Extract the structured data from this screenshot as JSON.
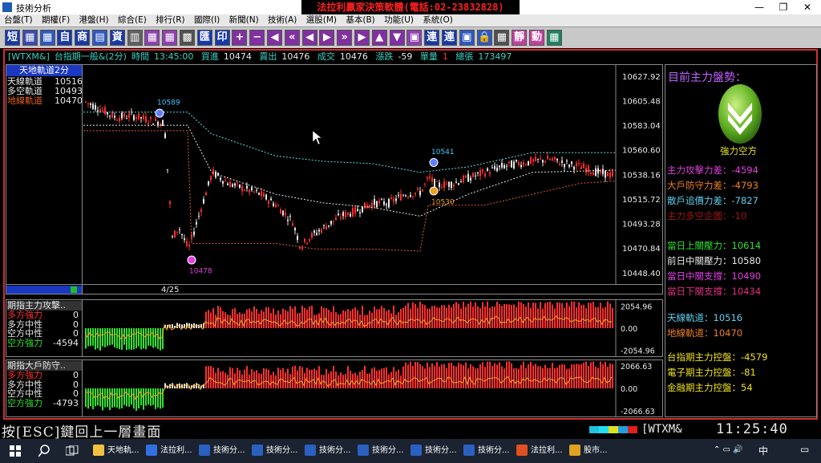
{
  "window": {
    "title": "技術分析",
    "banner": "法拉利贏家決策軟體(電話:02-23832828)",
    "controls": [
      "—",
      "❐",
      "✕"
    ]
  },
  "menu": [
    "台盤(T)",
    "期權(F)",
    "港盤(H)",
    "綜合(E)",
    "排行(R)",
    "國際(I)",
    "新聞(N)",
    "技術(A)",
    "選股(M)",
    "基本(B)",
    "功能(U)",
    "系統(O)"
  ],
  "toolbar": [
    {
      "label": "短",
      "bg": "#1838a8",
      "fg": "#fff"
    },
    {
      "label": "▦",
      "bg": "#3a4ab0",
      "fg": "#fff"
    },
    {
      "label": "▦",
      "bg": "#2c58c0",
      "fg": "#fff"
    },
    {
      "label": "自",
      "bg": "#1838a8",
      "fg": "#fff"
    },
    {
      "label": "商",
      "bg": "#1838a8",
      "fg": "#fff"
    },
    {
      "label": "▤",
      "bg": "#2c58c0",
      "fg": "#fff"
    },
    {
      "label": "資",
      "bg": "#1838a8",
      "fg": "#fff"
    },
    {
      "label": "▥",
      "bg": "#606060",
      "fg": "#fff"
    },
    {
      "label": "▦",
      "bg": "#9040b0",
      "fg": "#fff"
    },
    {
      "label": "▦",
      "bg": "#9040b0",
      "fg": "#fff"
    },
    {
      "label": "▩",
      "bg": "#505050",
      "fg": "#fff"
    },
    {
      "label": "匯",
      "bg": "#1838a8",
      "fg": "#fff"
    },
    {
      "label": "印",
      "bg": "#1838a8",
      "fg": "#fff"
    },
    {
      "label": "+",
      "bg": "#8030a0",
      "fg": "#fff"
    },
    {
      "label": "−",
      "bg": "#8030a0",
      "fg": "#fff"
    },
    {
      "label": "◀",
      "bg": "#8030a0",
      "fg": "#fff"
    },
    {
      "label": "«",
      "bg": "#8030a0",
      "fg": "#fff"
    },
    {
      "label": "◀",
      "bg": "#8030a0",
      "fg": "#fff"
    },
    {
      "label": "▶",
      "bg": "#8030a0",
      "fg": "#fff"
    },
    {
      "label": "»",
      "bg": "#8030a0",
      "fg": "#fff"
    },
    {
      "label": "▶",
      "bg": "#8030a0",
      "fg": "#fff"
    },
    {
      "label": "▲",
      "bg": "#8030a0",
      "fg": "#fff"
    },
    {
      "label": "▼",
      "bg": "#8030a0",
      "fg": "#fff"
    },
    {
      "label": "▣",
      "bg": "#9040b0",
      "fg": "#fff"
    },
    {
      "label": "連",
      "bg": "#1838a8",
      "fg": "#fff"
    },
    {
      "label": "連",
      "bg": "#1838a8",
      "fg": "#fff"
    },
    {
      "label": "▣",
      "bg": "#2c58c0",
      "fg": "#fff"
    },
    {
      "label": "🔒",
      "bg": "#2c58c0",
      "fg": "#fff"
    },
    {
      "label": "▦",
      "bg": "#505050",
      "fg": "#fff"
    },
    {
      "label": "靜",
      "bg": "#c040a0",
      "fg": "#fff"
    },
    {
      "label": "動",
      "bg": "#c040a0",
      "fg": "#fff"
    },
    {
      "label": "▦",
      "bg": "#208060",
      "fg": "#fff"
    }
  ],
  "infobar": {
    "symbol": "[WTXM&]",
    "name": "台指期一般&(2分)",
    "time_label": "時間",
    "time": "13:45:00",
    "bid_label": "買進",
    "bid": "10474",
    "ask_label": "賣出",
    "ask": "10476",
    "deal_label": "成交",
    "deal": "10476",
    "change_label": "漲跌",
    "change": "-59",
    "vol_label": "單量",
    "vol": "1",
    "total_label": "總張",
    "total": "173497"
  },
  "main_chart": {
    "title": "天地軌道2分",
    "legend": [
      {
        "label": "天線軌道",
        "value": "10516",
        "color": "#e8e8e8"
      },
      {
        "label": "多空軌道",
        "value": "10493",
        "color": "#e8e8e8"
      },
      {
        "label": "地線軌道",
        "value": "10470",
        "color": "#e06020"
      }
    ],
    "annotations": [
      {
        "text": "10589",
        "color": "#40c8ff"
      },
      {
        "text": "10541",
        "color": "#40c8ff"
      },
      {
        "text": "10530",
        "color": "#f0a020"
      },
      {
        "text": "10478",
        "color": "#e040e0"
      }
    ],
    "date_label": "4/25"
  },
  "chart_data": [
    {
      "type": "candlestick",
      "title": "天地軌道2分",
      "y_ticks": [
        "10627.92",
        "10605.48",
        "10583.04",
        "10560.60",
        "10538.16",
        "10515.72",
        "10493.28",
        "10470.84",
        "10448.40"
      ],
      "ylim": [
        10438,
        10638
      ],
      "x_label": "4/25",
      "series": [
        {
          "name": "天線軌道",
          "color": "#60e0e0",
          "style": "dotted",
          "points": [
            [
              0,
              10595
            ],
            [
              130,
              10595
            ],
            [
              160,
              10575
            ],
            [
              240,
              10555
            ],
            [
              300,
              10550
            ],
            [
              360,
              10548
            ],
            [
              420,
              10540
            ],
            [
              480,
              10545
            ],
            [
              560,
              10558
            ],
            [
              664,
              10558
            ]
          ]
        },
        {
          "name": "多空軌道",
          "color": "#e8e8e8",
          "style": "dotted",
          "points": [
            [
              0,
              10583
            ],
            [
              130,
              10583
            ],
            [
              160,
              10540
            ],
            [
              240,
              10520
            ],
            [
              300,
              10512
            ],
            [
              360,
              10508
            ],
            [
              420,
              10500
            ],
            [
              480,
              10520
            ],
            [
              560,
              10540
            ],
            [
              664,
              10542
            ]
          ]
        },
        {
          "name": "地線軌道",
          "color": "#e06020",
          "style": "dotted",
          "points": [
            [
              0,
              10578
            ],
            [
              130,
              10578
            ],
            [
              135,
              10475
            ],
            [
              240,
              10475
            ],
            [
              290,
              10470
            ],
            [
              360,
              10470
            ],
            [
              420,
              10468
            ],
            [
              430,
              10510
            ],
            [
              500,
              10510
            ],
            [
              560,
              10520
            ],
            [
              620,
              10530
            ],
            [
              664,
              10532
            ]
          ]
        }
      ]
    },
    {
      "type": "bar",
      "title": "期指主力攻擊",
      "y_ticks": [
        "2054.96",
        "0.00",
        "-2054.96"
      ],
      "ylim": [
        -2600,
        2600
      ],
      "legend": [
        {
          "label": "多方強力",
          "value": "0",
          "color": "#ff3030"
        },
        {
          "label": "多方中性",
          "value": "0",
          "color": "#e8e8e8"
        },
        {
          "label": "空方中性",
          "value": "0",
          "color": "#e8e8e8"
        },
        {
          "label": "空方強力",
          "value": "-4594",
          "color": "#30e030"
        }
      ]
    },
    {
      "type": "bar",
      "title": "期指大戶防守",
      "y_ticks": [
        "2066.63",
        "0.00",
        "-2066.63"
      ],
      "ylim": [
        -2600,
        2600
      ],
      "legend": [
        {
          "label": "多方強力",
          "value": "0",
          "color": "#ff3030"
        },
        {
          "label": "多方中性",
          "value": "0",
          "color": "#e8e8e8"
        },
        {
          "label": "空方中性",
          "value": "0",
          "color": "#e8e8e8"
        },
        {
          "label": "空方強力",
          "value": "-4793",
          "color": "#30e030"
        }
      ]
    }
  ],
  "indicators": {
    "ind1_title": "期指主力攻擊..",
    "ind2_title": "期指大戶防守.."
  },
  "right_panel": {
    "header": "目前主力盤勢：",
    "status": "強力空方",
    "forces": [
      {
        "label": "主力攻擊力差",
        "value": "-4594",
        "color": "#e040e0"
      },
      {
        "label": "大戶防守力差",
        "value": "-4793",
        "color": "#f08020"
      },
      {
        "label": "散戶追價力差",
        "value": "-7827",
        "color": "#60d0f0"
      },
      {
        "label": "主力多空企圖",
        "value": "-10",
        "color": "#a01818"
      }
    ],
    "levels": [
      {
        "label": "當日上關壓力",
        "value": "10614",
        "color": "#30e030"
      },
      {
        "label": "前日中關壓力",
        "value": "10580",
        "color": "#e8e8e8"
      },
      {
        "label": "當日中關支撐",
        "value": "10490",
        "color": "#e040e0"
      },
      {
        "label": "當日下關支撐",
        "value": "10434",
        "color": "#e03080"
      }
    ],
    "tracks": [
      {
        "label": "天線軌道",
        "value": "10516",
        "color": "#60d0f0"
      },
      {
        "label": "地線軌道",
        "value": "10470",
        "color": "#f08020"
      }
    ],
    "controls": [
      {
        "label": "台指期主力控盤",
        "value": "-4579",
        "color": "#f0e020"
      },
      {
        "label": "電子期主力控盤",
        "value": "-81",
        "color": "#f0e020"
      },
      {
        "label": "金融期主力控盤",
        "value": "54",
        "color": "#f0e020"
      }
    ]
  },
  "status": {
    "esc": "按[ESC]鍵回上一層畫面",
    "symbol": "[WTXM&",
    "clock": "11:25:40"
  },
  "taskbar": [
    {
      "label": "天地軌...",
      "color": "#f0c040"
    },
    {
      "label": "法拉利...",
      "color": "#3070e0"
    },
    {
      "label": "技術分...",
      "color": "#2a60c0"
    },
    {
      "label": "技術分...",
      "color": "#2a60c0"
    },
    {
      "label": "技術分...",
      "color": "#2a60c0"
    },
    {
      "label": "技術分...",
      "color": "#2a60c0"
    },
    {
      "label": "技術分...",
      "color": "#2a60c0"
    },
    {
      "label": "技術分...",
      "color": "#2a60c0"
    },
    {
      "label": "法拉利...",
      "color": "#e05020"
    },
    {
      "label": "股市...",
      "color": "#e0a020"
    }
  ]
}
